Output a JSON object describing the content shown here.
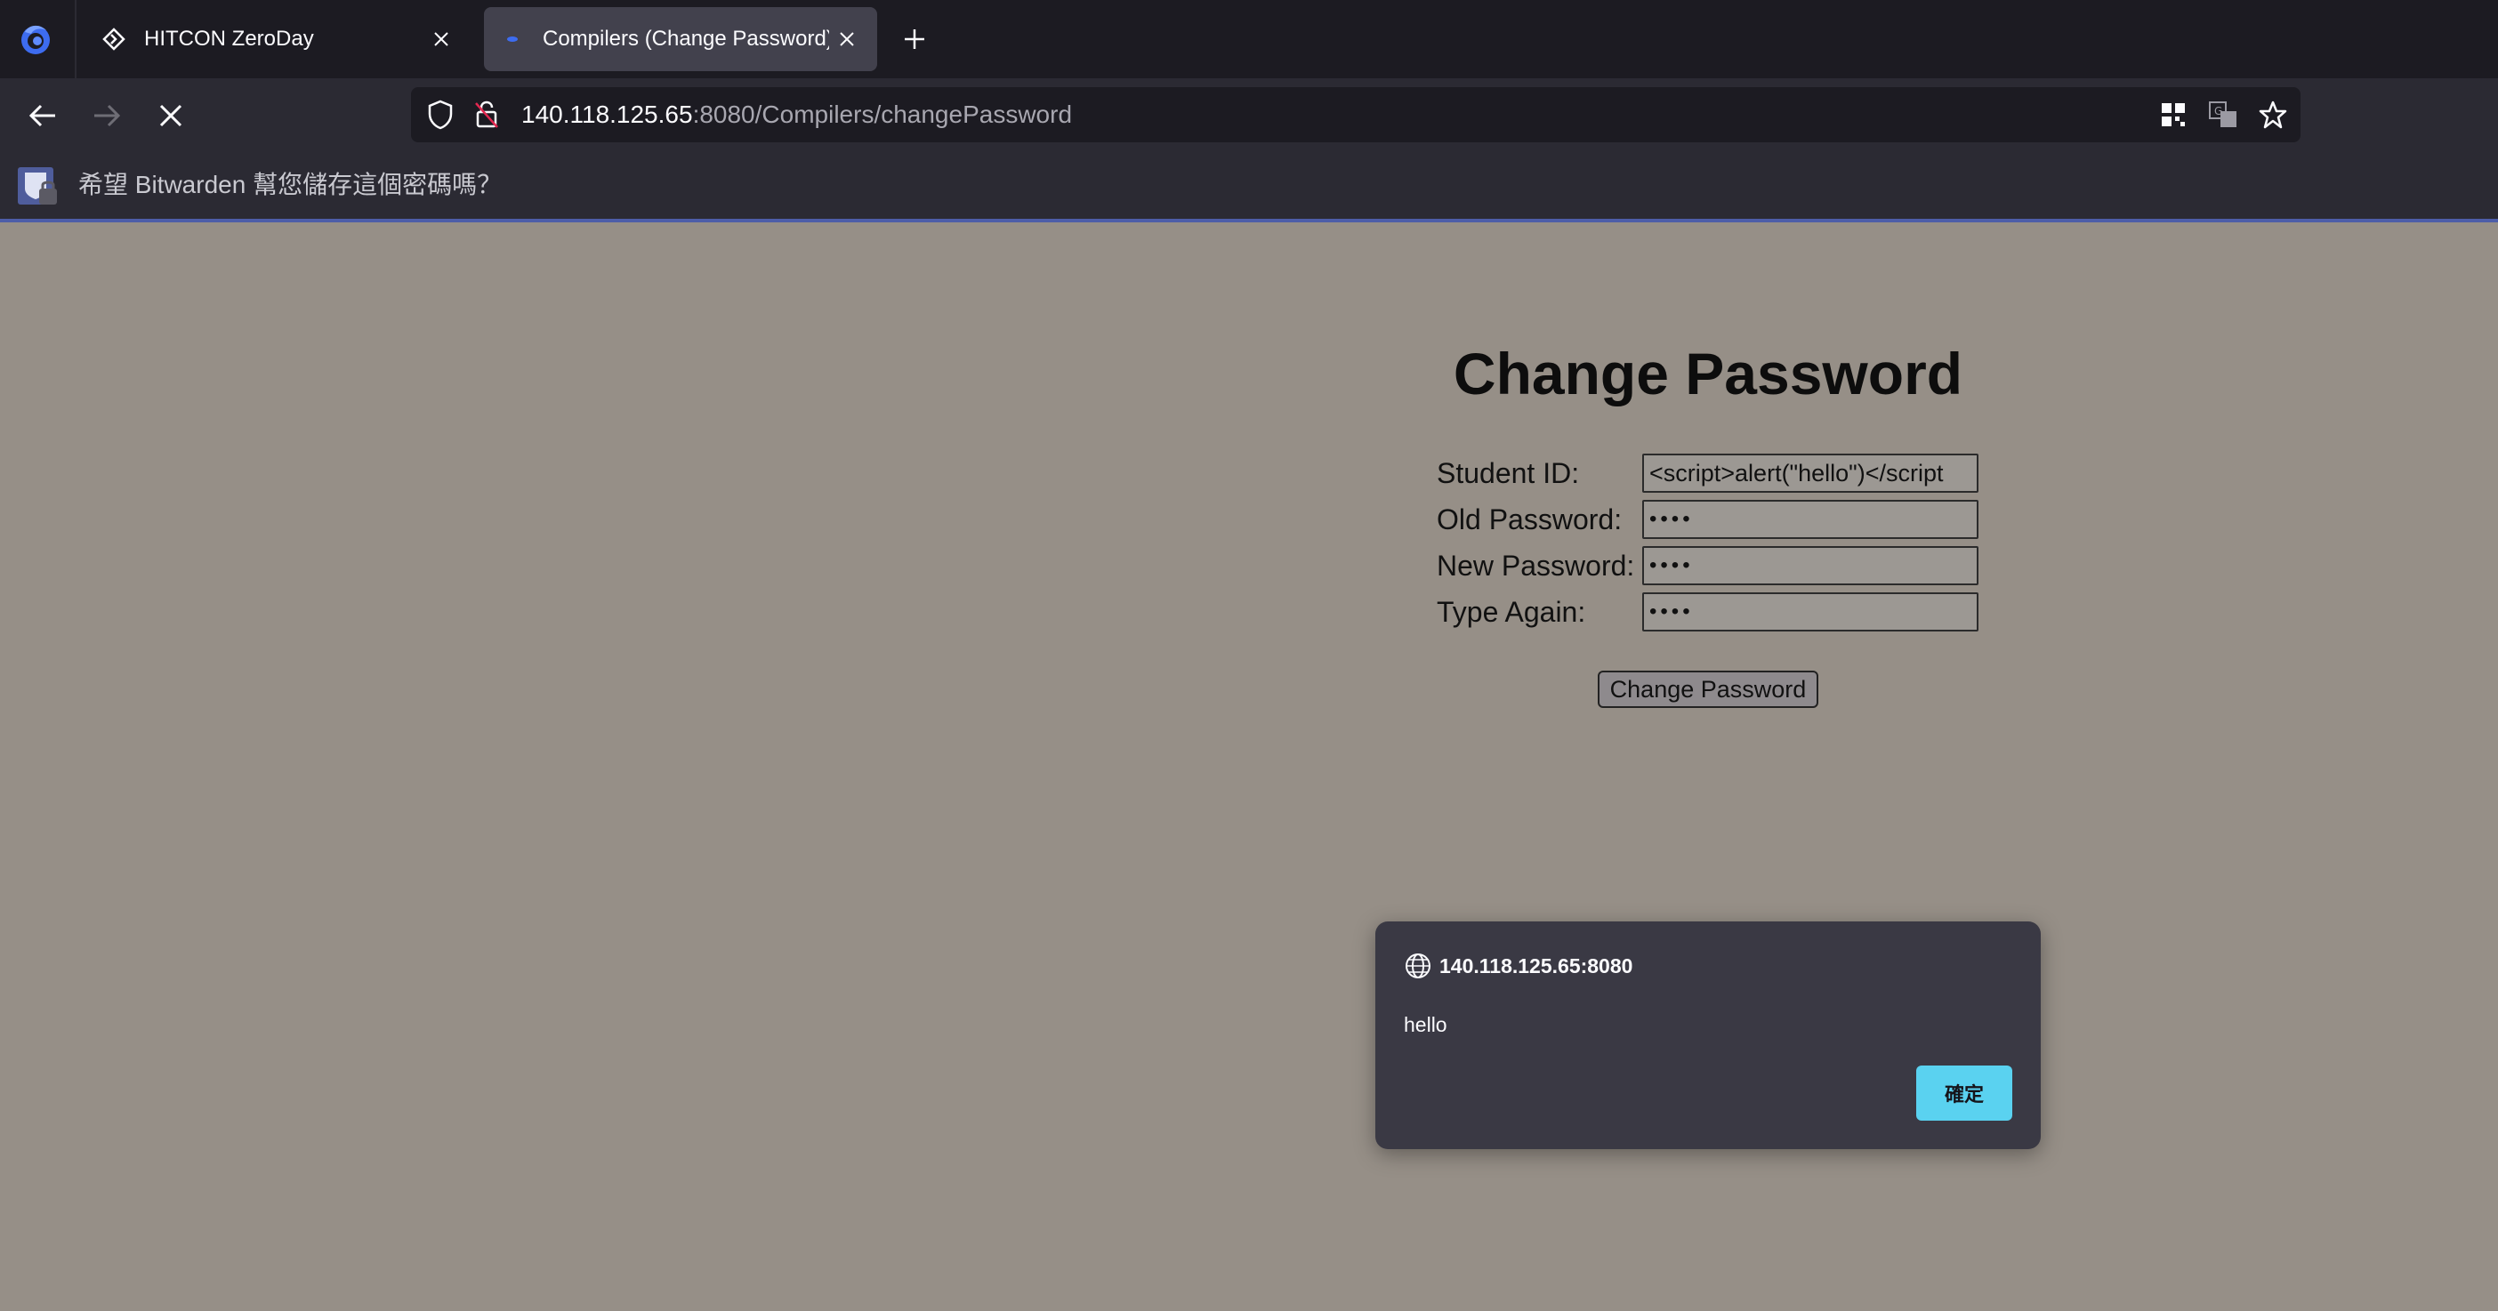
{
  "browser": {
    "tabs": [
      {
        "title": "HITCON ZeroDay",
        "active": false,
        "favicon": "hitcon-zeroday-favicon"
      },
      {
        "title": "Compilers (Change Password)",
        "active": true,
        "favicon": "page-dot-favicon"
      }
    ],
    "url": {
      "host": "140.118.125.65",
      "rest": ":8080/Compilers/changePassword"
    },
    "toolbar_icons": [
      "qr-code-icon",
      "translate-icon",
      "bookmark-star-icon"
    ]
  },
  "notification": {
    "text": "希望 Bitwarden 幫您儲存這個密碼嗎？",
    "icon": "bitwarden-icon"
  },
  "page": {
    "heading": "Change Password",
    "form": {
      "student_id_label": "Student ID:",
      "student_id_value": "<script>alert(\"hello\")</script",
      "old_password_label": "Old Password:",
      "old_password_value": "••••",
      "new_password_label": "New Password:",
      "new_password_value": "••••",
      "type_again_label": "Type Again:",
      "type_again_value": "••••",
      "submit_label": "Change Password"
    }
  },
  "dialog": {
    "origin": "140.118.125.65:8080",
    "message": "hello",
    "ok_label": "確定"
  },
  "colors": {
    "page_bg": "#968f87",
    "chrome_dark": "#1c1b22",
    "chrome_mid": "#2b2a33",
    "dialog_bg": "#3a3944",
    "accent_button": "#5ad2f0"
  }
}
